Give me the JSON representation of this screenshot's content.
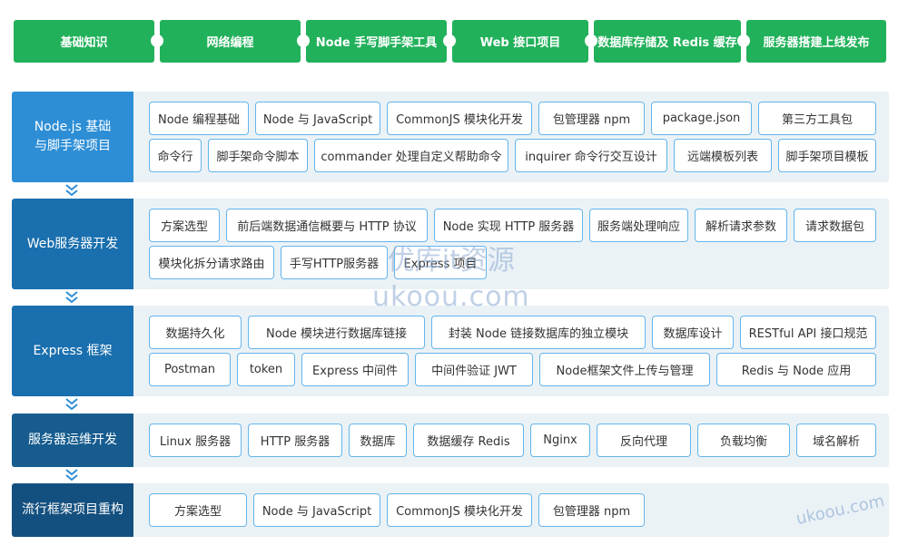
{
  "steps": [
    "基础知识",
    "网络编程",
    "Node 手写脚手架工具",
    "Web 接口项目",
    "数据库存储及 Redis 缓存",
    "服务器搭建上线发布"
  ],
  "sections": [
    {
      "title": "Node.js 基础\n与脚手架项目",
      "rows": [
        [
          "Node 编程基础",
          "Node 与 JavaScript",
          "CommonJS 模块化开发",
          "包管理器 npm",
          "package.json",
          "第三方工具包"
        ],
        [
          "命令行",
          "脚手架命令脚本",
          "commander 处理自定义帮助命令",
          "inquirer 命令行交互设计",
          "远端模板列表",
          "脚手架项目模板"
        ]
      ]
    },
    {
      "title": "Web服务器开发",
      "rows": [
        [
          "方案选型",
          "前后端数据通信概要与 HTTP 协议",
          "Node 实现 HTTP 服务器",
          "服务端处理响应",
          "解析请求参数",
          "请求数据包"
        ],
        [
          "模块化拆分请求路由",
          "手写HTTP服务器",
          "Express 项目"
        ]
      ]
    },
    {
      "title": "Express 框架",
      "rows": [
        [
          "数据持久化",
          "Node 模块进行数据库链接",
          "封装 Node 链接数据库的独立模块",
          "数据库设计",
          "RESTful API 接口规范"
        ],
        [
          "Postman",
          "token",
          "Express 中间件",
          "中间件验证 JWT",
          "Node框架文件上传与管理",
          "Redis 与 Node 应用"
        ]
      ]
    },
    {
      "title": "服务器运维开发",
      "rows": [
        [
          "Linux 服务器",
          "HTTP 服务器",
          "数据库",
          "数据缓存 Redis",
          "Nginx",
          "反向代理",
          "负载均衡",
          "域名解析"
        ]
      ]
    },
    {
      "title": "流行框架项目重构",
      "rows": [
        [
          "方案选型",
          "Node 与 JavaScript",
          "CommonJS 模块化开发",
          "包管理器 npm"
        ]
      ]
    }
  ],
  "watermark": {
    "line1": "优库it资源",
    "line2": "ukoou.com",
    "corner": "ukoou.com"
  },
  "colors": {
    "green": "#22b15b",
    "blue": "#2d8ed6",
    "border": "#64b5ec",
    "panel": "#ebf2f6"
  },
  "icons": {
    "arrow": "double-chevron-down-icon"
  }
}
